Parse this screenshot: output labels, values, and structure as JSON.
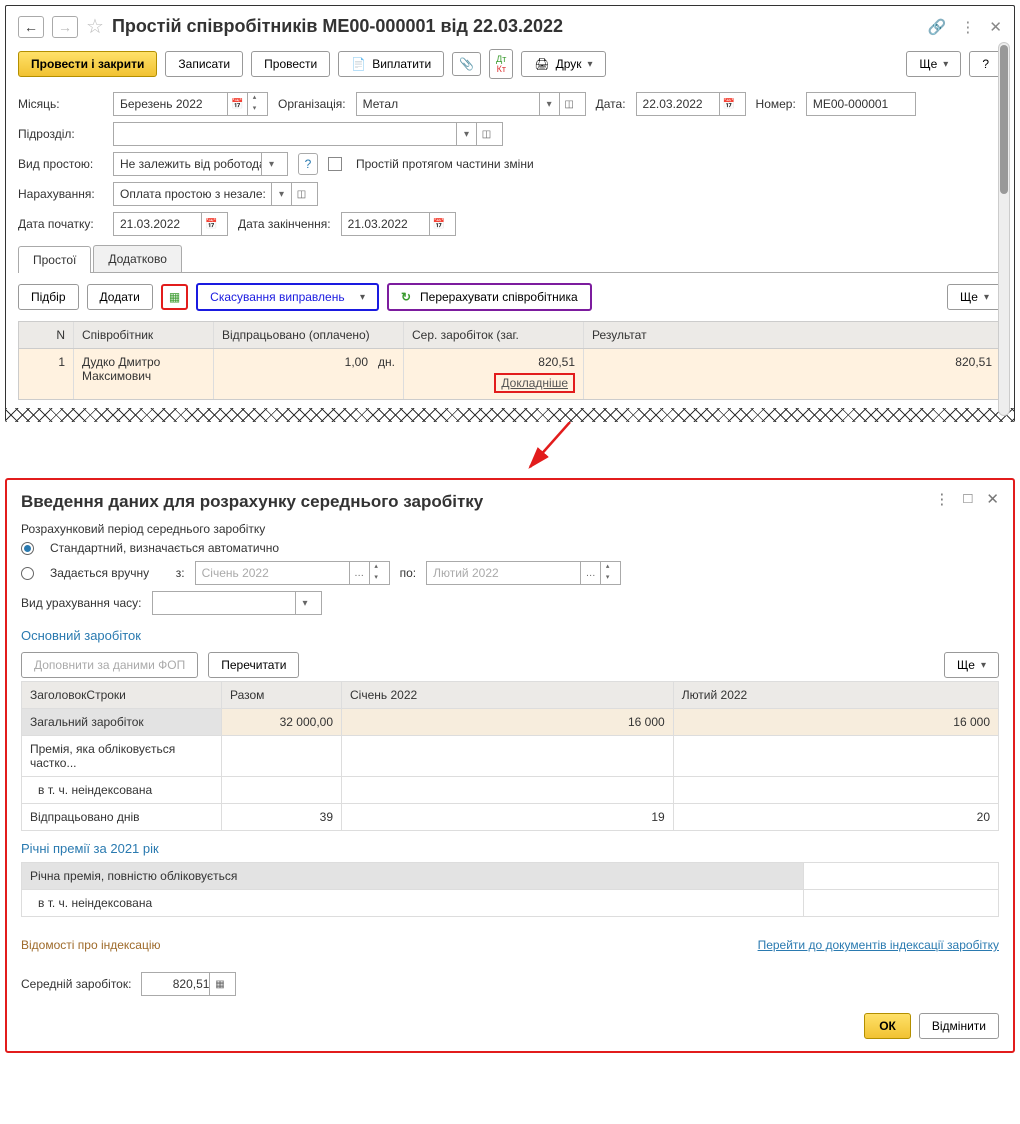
{
  "top": {
    "title": "Простій співробітників МЕ00-000001 від 22.03.2022",
    "toolbar": {
      "post_close": "Провести і закрити",
      "save": "Записати",
      "post": "Провести",
      "pay": "Виплатити",
      "print": "Друк",
      "more": "Ще",
      "help": "?"
    },
    "fields": {
      "month_lbl": "Місяць:",
      "month_val": "Березень 2022",
      "org_lbl": "Організація:",
      "org_val": "Метал",
      "date_lbl": "Дата:",
      "date_val": "22.03.2022",
      "num_lbl": "Номер:",
      "num_val": "МЕ00-000001",
      "dept_lbl": "Підрозділ:",
      "dept_val": "",
      "type_lbl": "Вид простою:",
      "type_val": "Не залежить від роботода",
      "partial_lbl": "Простій протягом частини зміни",
      "accr_lbl": "Нарахування:",
      "accr_val": "Оплата простою з незале:",
      "start_lbl": "Дата початку:",
      "start_val": "21.03.2022",
      "end_lbl": "Дата закінчення:",
      "end_val": "21.03.2022"
    },
    "tabs": {
      "t1": "Простої",
      "t2": "Додатково"
    },
    "sub": {
      "pick": "Підбір",
      "add": "Додати",
      "cancel_corr": "Скасування виправлень",
      "recalc": "Перерахувати співробітника",
      "more": "Ще"
    },
    "grid": {
      "h_n": "N",
      "h_emp": "Співробітник",
      "h_wrk": "Відпрацьовано (оплачено)",
      "h_avg": "Сер. заробіток (заг.",
      "h_res": "Результат",
      "r1_n": "1",
      "r1_emp": "Дудко Дмитро Максимович",
      "r1_wrk": "1,00",
      "r1_unit": "дн.",
      "r1_avg": "820,51",
      "r1_res": "820,51",
      "detail": "Докладніше"
    }
  },
  "dlg": {
    "title": "Введення даних для розрахунку середнього заробітку",
    "period_lbl": "Розрахунковий період середнього заробітку",
    "r1": "Стандартний, визначається автоматично",
    "r2": "Задається вручну",
    "from_lbl": "з:",
    "from_val": "Січень 2022",
    "to_lbl": "по:",
    "to_val": "Лютий 2022",
    "timeacc_lbl": "Вид урахування часу:",
    "sec_main": "Основний заробіток",
    "fop": "Доповнити за даними ФОП",
    "reread": "Перечитати",
    "more": "Ще",
    "tbl": {
      "h1": "ЗаголовокСтроки",
      "h2": "Разом",
      "h3": "Січень 2022",
      "h4": "Лютий 2022",
      "r1": "Загальний заробіток",
      "r1_sum": "32 000,00",
      "r1_jan": "16 000",
      "r1_feb": "16 000",
      "r2": "Премія, яка обліковується частко...",
      "r3": "в т. ч. неіндексована",
      "r4": "Відпрацьовано днів",
      "r4_sum": "39",
      "r4_jan": "19",
      "r4_feb": "20"
    },
    "sec_annual": "Річні премії за 2021 рік",
    "annual_r1": "Річна премія, повністю обліковується",
    "annual_r2": "в т. ч. неіндексована",
    "index_info": "Відомості про індексацію",
    "index_link": "Перейти до документів індексації заробітку",
    "avg_lbl": "Середній заробіток:",
    "avg_val": "820,51",
    "ok": "ОК",
    "cancel": "Відмінити"
  }
}
